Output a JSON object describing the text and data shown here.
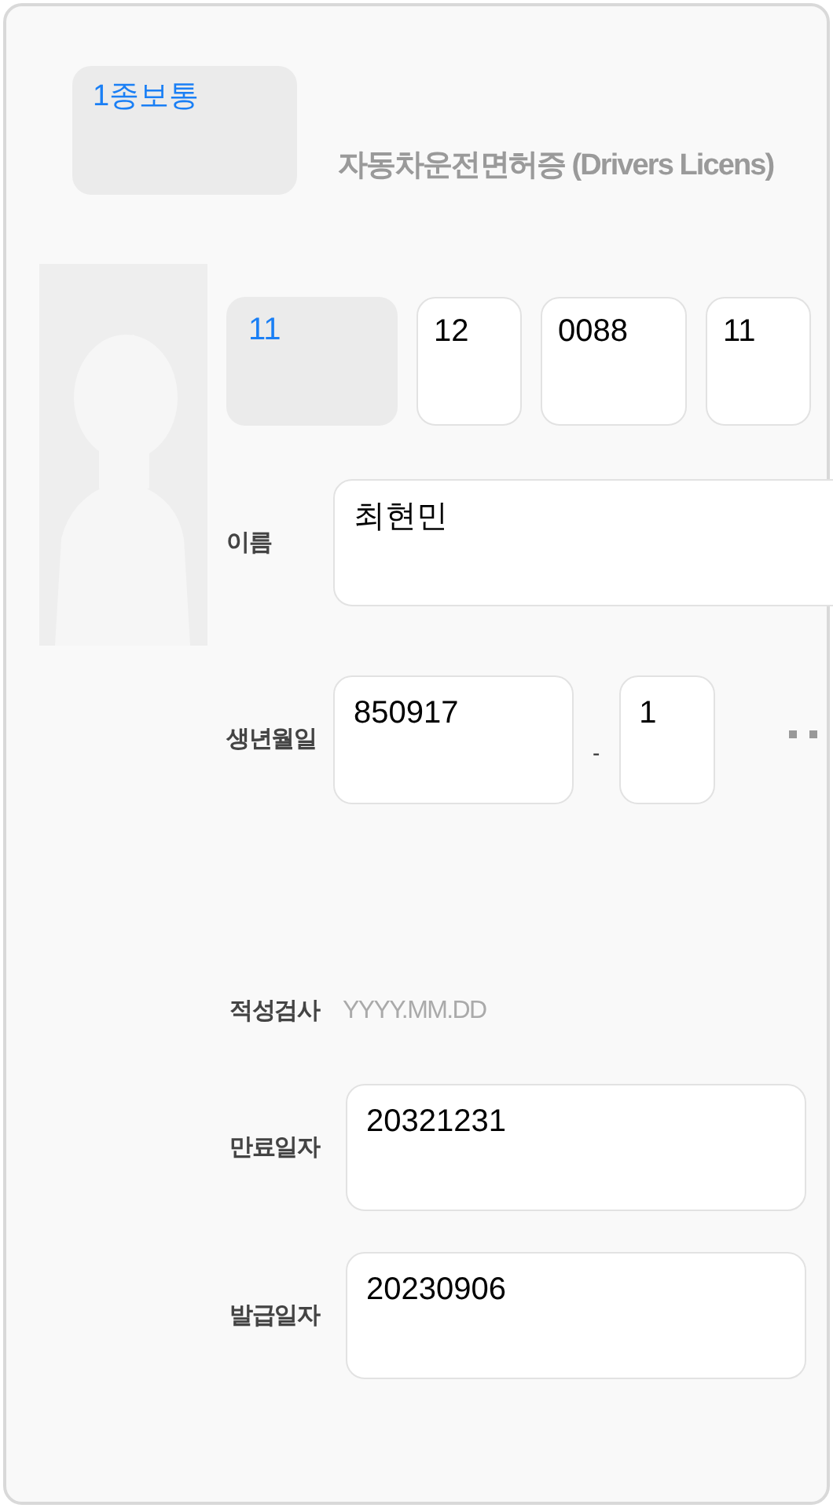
{
  "license_type": {
    "value": "1종보통"
  },
  "title": "자동차운전면허증 (Drivers Licens)",
  "license_number": [
    {
      "kind": "select",
      "value": "11"
    },
    {
      "kind": "text",
      "value": "12"
    },
    {
      "kind": "text",
      "value": "0088"
    },
    {
      "kind": "text",
      "value": "11"
    }
  ],
  "name": {
    "label": "이름",
    "value": "최현민"
  },
  "birth": {
    "label": "생년월일",
    "value": "850917",
    "separator": "-",
    "gender_digit": "1"
  },
  "aptitude_test": {
    "label": "적성검사",
    "placeholder": "YYYY.MM.DD"
  },
  "expiry_date": {
    "label": "만료일자",
    "value": "20321231"
  },
  "issue_date": {
    "label": "발급일자",
    "value": "20230906"
  }
}
